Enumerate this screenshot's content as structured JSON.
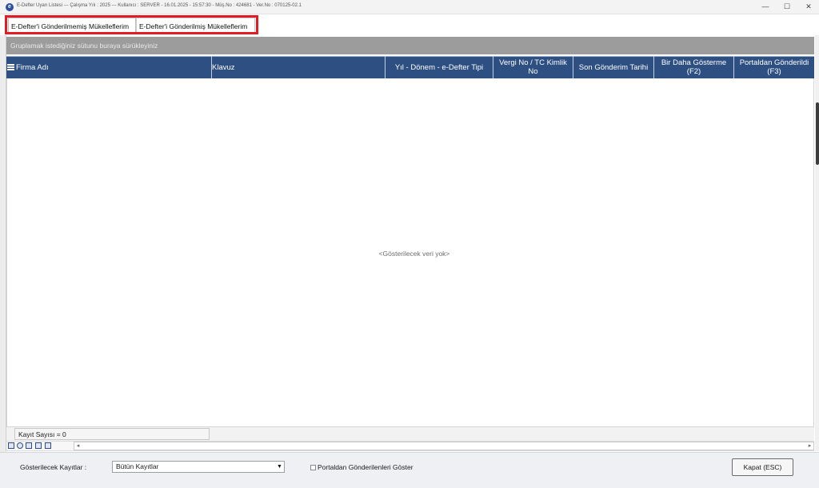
{
  "window": {
    "title": "E-Defter Uyarı Listesi   ---   Çalışma Yılı : 2025   ---   Kullanıcı : SERVER  -  16.01.2025  -  15:57:30  -  Müş.No : 424681  -  Ver.No : 070125-02.1",
    "minimize": "—",
    "maximize": "☐",
    "close": "✕"
  },
  "tabs": [
    {
      "label": "E-Defter'i Gönderilmemiş Mükelleflerim"
    },
    {
      "label": "E-Defter'i Gönderilmiş Mükelleflerim"
    }
  ],
  "grid": {
    "group_hint": "Gruplamak istediğiniz sütunu buraya sürükleyiniz",
    "columns": [
      "Firma Adı",
      "Klavuz",
      "Yıl - Dönem - e-Defter Tipi",
      "Vergi No / TC Kimlik No",
      "Son Gönderim Tarihi",
      "Bir Daha Gösterme (F2)",
      "Portaldan Gönderildi (F3)"
    ],
    "rows": [],
    "empty_message": "<Gösterilecek veri yok>",
    "record_count": "Kayıt Sayısı = 0"
  },
  "bottom": {
    "filter_label": "Gösterilecek Kayıtlar :",
    "filter_value": "Bütün Kayıtlar",
    "checkbox_label": "Portaldan Gönderilenleri Göster",
    "checkbox_checked": false,
    "close_button": "Kapat (ESC)"
  },
  "colors": {
    "header_bg": "#2d4f82",
    "group_panel_bg": "#9c9c9c",
    "highlight": "#e31b23"
  }
}
